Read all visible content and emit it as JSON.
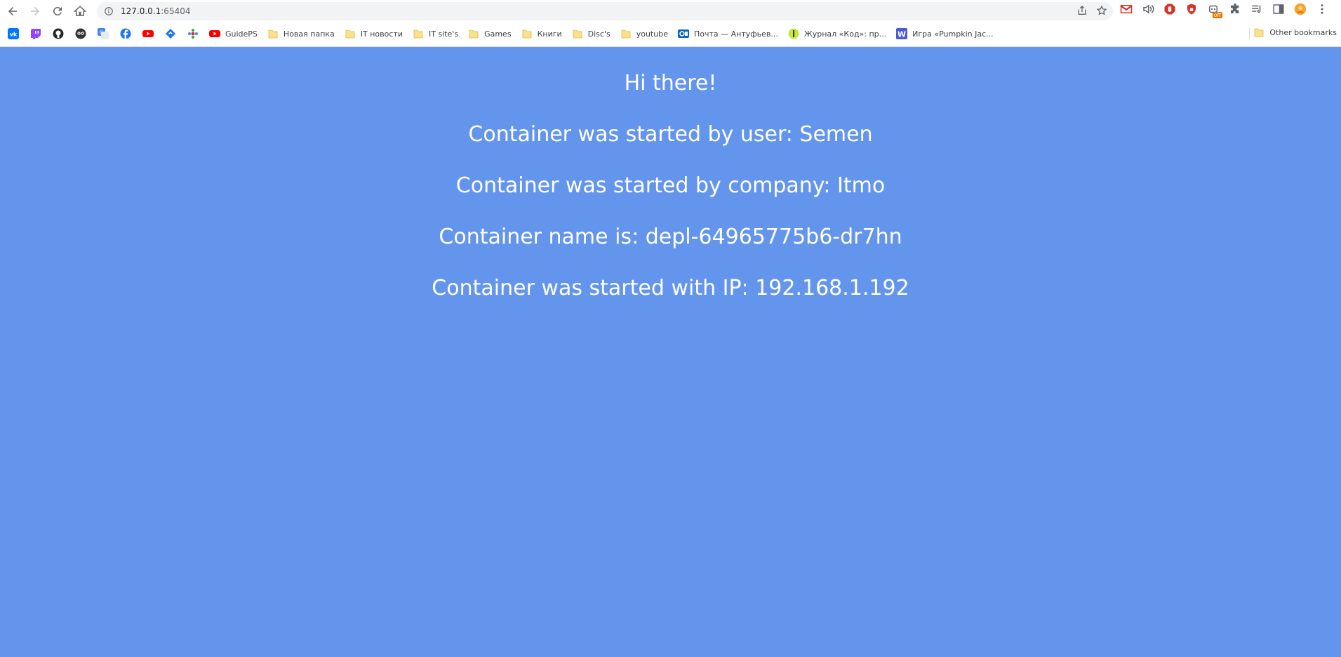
{
  "browser": {
    "url_host": "127.0.0.1",
    "url_port": ":65404",
    "extensions_off_badge": "off"
  },
  "bookmarks": {
    "icon_only": [
      {
        "icon": "vk-icon",
        "color": "#0077ff"
      },
      {
        "icon": "twitch-icon",
        "color": "#9146ff"
      },
      {
        "icon": "github-icon",
        "color": "#24292e"
      },
      {
        "icon": "owl-icon",
        "color": "#333333"
      },
      {
        "icon": "google-translate-icon",
        "color": "#4285f4"
      },
      {
        "icon": "facebook-icon",
        "color": "#1877f2"
      },
      {
        "icon": "youtube-icon",
        "color": "#ff0000"
      },
      {
        "icon": "diamond-icon",
        "color": "#1a73e8"
      },
      {
        "icon": "ornament-icon",
        "color": "#d93025"
      }
    ],
    "items": [
      {
        "label": "GuidePS",
        "icon": "youtube-icon"
      },
      {
        "label": "Новая папка",
        "icon": "folder-icon"
      },
      {
        "label": "IT новости",
        "icon": "folder-icon"
      },
      {
        "label": "IT site's",
        "icon": "folder-icon"
      },
      {
        "label": "Games",
        "icon": "folder-icon"
      },
      {
        "label": "Книги",
        "icon": "folder-icon"
      },
      {
        "label": "Disc's",
        "icon": "folder-icon"
      },
      {
        "label": "youtube",
        "icon": "folder-icon"
      },
      {
        "label": "Почта — Антуфьев...",
        "icon": "outlook-icon"
      },
      {
        "label": "Журнал «Код»: пр...",
        "icon": "kod-icon"
      },
      {
        "label": "Игра «Pumpkin Jac...",
        "icon": "w-icon"
      }
    ],
    "other_label": "Other bookmarks"
  },
  "page": {
    "background": "#6495ed",
    "line1": "Hi there!",
    "line2": "Container was started by user: Semen",
    "line3": "Container was started by company: Itmo",
    "line4": "Container name is: depl-64965775b6-dr7hn",
    "line5": "Container was started with IP: 192.168.1.192"
  }
}
